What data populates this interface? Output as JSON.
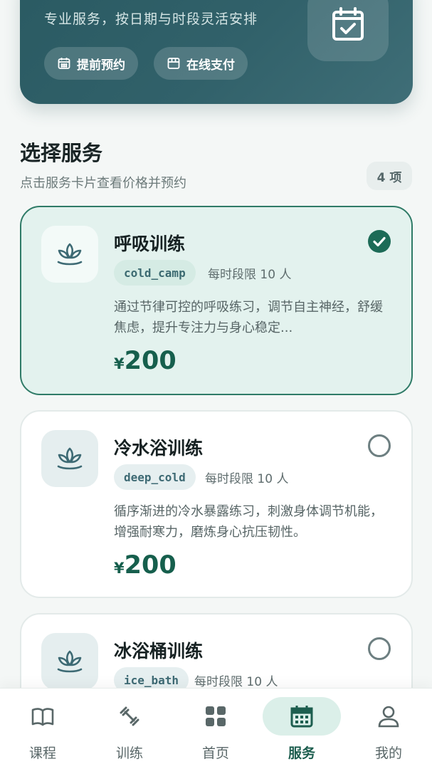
{
  "hero": {
    "subtitle": "专业服务，按日期与时段灵活安排",
    "chips": [
      {
        "label": "提前预约",
        "icon": "calendar-icon"
      },
      {
        "label": "在线支付",
        "icon": "store-icon"
      }
    ],
    "icon": "calendar-check-icon"
  },
  "section": {
    "title": "选择服务",
    "subtitle": "点击服务卡片查看价格并预约",
    "count": "4 项"
  },
  "services": [
    {
      "name": "呼吸训练",
      "code": "cold_camp",
      "limit": "每时段限 10 人",
      "desc": "通过节律可控的呼吸练习，调节自主神经，舒缓焦虑，提升专注力与身心稳定...",
      "currency": "¥",
      "price": "200",
      "selected": true,
      "icon": "lotus-icon"
    },
    {
      "name": "冷水浴训练",
      "code": "deep_cold",
      "limit": "每时段限 10 人",
      "desc": "循序渐进的冷水暴露练习，刺激身体调节机能，增强耐寒力，磨炼身心抗压韧性。",
      "currency": "¥",
      "price": "200",
      "selected": false,
      "icon": "lotus-icon"
    },
    {
      "name": "冰浴桶训练",
      "code": "ice_bath",
      "limit": "每时段限 10 人",
      "selected": false,
      "icon": "lotus-icon"
    }
  ],
  "nav": {
    "items": [
      {
        "label": "课程",
        "icon": "book-icon"
      },
      {
        "label": "训练",
        "icon": "dumbbell-icon"
      },
      {
        "label": "首页",
        "icon": "grid-icon"
      },
      {
        "label": "服务",
        "icon": "calendar-icon",
        "active": true
      },
      {
        "label": "我的",
        "icon": "person-icon"
      }
    ]
  },
  "colors": {
    "brand": "#2a5a62",
    "accent": "#165f4d",
    "selected_border": "#2f7b67",
    "selected_bg": "#e3f2ee"
  }
}
